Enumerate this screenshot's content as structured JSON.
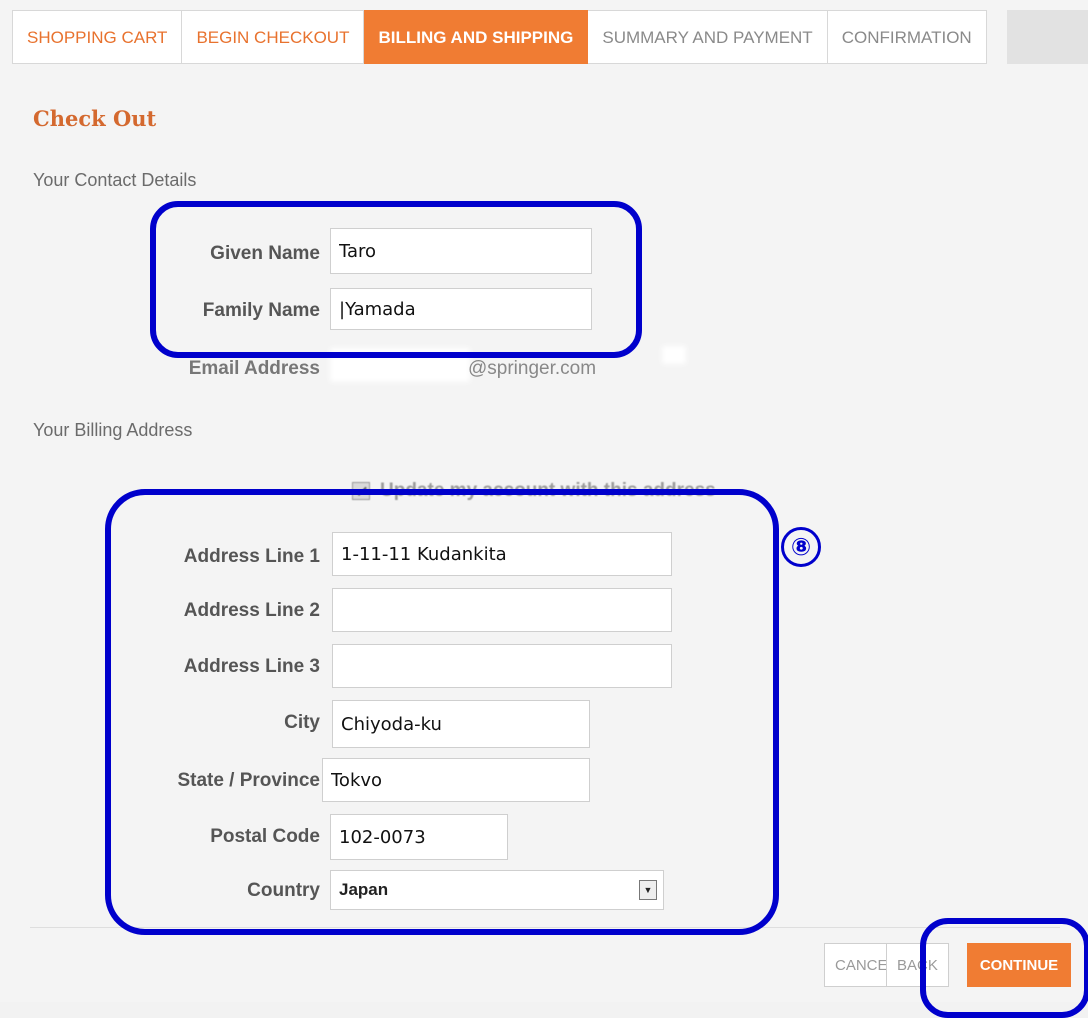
{
  "steps": [
    {
      "label": "SHOPPING CART",
      "state": "done"
    },
    {
      "label": "BEGIN CHECKOUT",
      "state": "done"
    },
    {
      "label": "BILLING AND SHIPPING",
      "state": "active"
    },
    {
      "label": "SUMMARY AND PAYMENT",
      "state": "todo"
    },
    {
      "label": "CONFIRMATION",
      "state": "todo"
    }
  ],
  "page": {
    "title": "Check Out",
    "contact_section": "Your Contact Details",
    "billing_section": "Your Billing Address"
  },
  "contact": {
    "given_name_label": "Given Name",
    "given_name": "Taro",
    "family_name_label": "Family Name",
    "family_name": "|Yamada",
    "email_label": "Email Address",
    "email_visible": "@springer.com"
  },
  "billing": {
    "update_account_label": "Update my account with this address",
    "update_account_checked": true,
    "address1_label": "Address Line 1",
    "address1": "1-11-11 Kudankita",
    "address2_label": "Address Line 2",
    "address2": "",
    "address3_label": "Address Line 3",
    "address3": "",
    "city_label": "City",
    "city": "Chiyoda-ku",
    "state_label": "State / Province",
    "state": "Tokvo",
    "postal_label": "Postal Code",
    "postal": "102-0073",
    "country_label": "Country",
    "country": "Japan"
  },
  "buttons": {
    "cancel": "CANCEL",
    "back": "BACK",
    "continue": "CONTINUE"
  },
  "annotation": {
    "marker": "⑧"
  },
  "colors": {
    "accent": "#f07c33",
    "highlight": "#0000cc"
  }
}
